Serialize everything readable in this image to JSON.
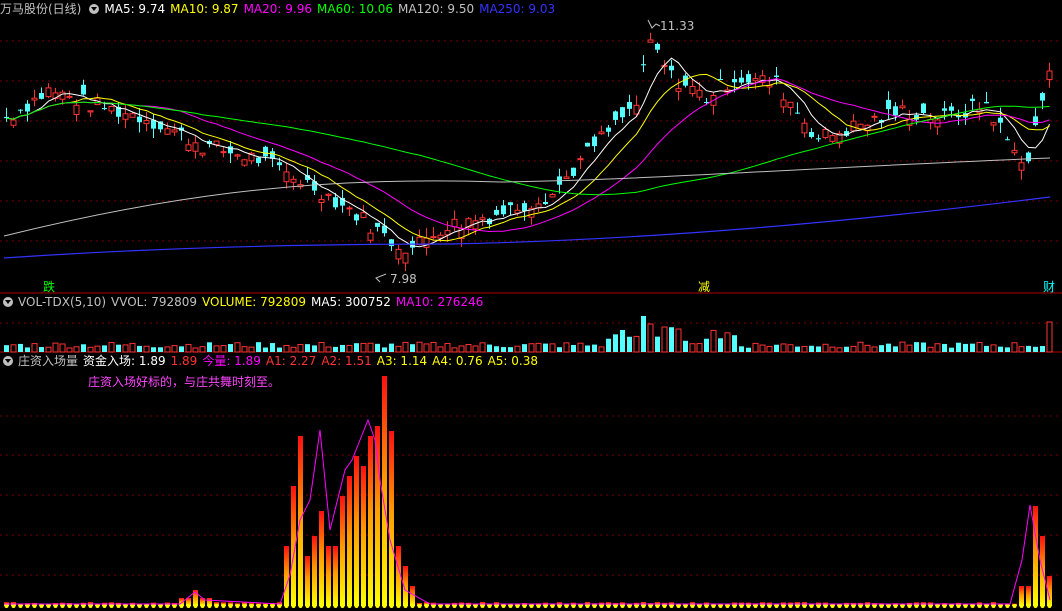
{
  "panel_main": {
    "title": "万马股份(日线)",
    "ma": [
      {
        "label": "MA5: 9.74",
        "color": "#ffffff"
      },
      {
        "label": "MA10: 9.87",
        "color": "#ffff00"
      },
      {
        "label": "MA20: 9.96",
        "color": "#ff00ff"
      },
      {
        "label": "MA60: 10.06",
        "color": "#00ff00"
      },
      {
        "label": "MA120: 9.50",
        "color": "#c0c0c0"
      },
      {
        "label": "MA250: 9.03",
        "color": "#3333ff"
      }
    ],
    "high_label": "11.33",
    "low_label": "7.98",
    "signals": [
      {
        "text": "跌",
        "color": "#00ff00"
      },
      {
        "text": "减",
        "color": "#ffff00"
      },
      {
        "text": "财",
        "color": "#00ffff"
      }
    ]
  },
  "panel_vol": {
    "title": "VOL-TDX(5,10)",
    "items": [
      {
        "label": "VVOL: 792809",
        "color": "#c0c0c0"
      },
      {
        "label": "VOLUME: 792809",
        "color": "#ffff00"
      },
      {
        "label": "MA5: 300752",
        "color": "#ffffff"
      },
      {
        "label": "MA10: 276246",
        "color": "#ff00ff"
      }
    ]
  },
  "panel_ind": {
    "title": "庄资入场量",
    "items": [
      {
        "label": "资金入场: 1.89",
        "color": "#ffffff"
      },
      {
        "label": "1.89",
        "color": "#ff3333"
      },
      {
        "label": "今量: 1.89",
        "color": "#ff00ff"
      },
      {
        "label": "A1: 2.27",
        "color": "#ff3333"
      },
      {
        "label": "A2: 1.51",
        "color": "#ff3333"
      },
      {
        "label": "A3: 1.14",
        "color": "#ffff00"
      },
      {
        "label": "A4: 0.76",
        "color": "#ffff00"
      },
      {
        "label": "A5: 0.38",
        "color": "#ffff00"
      }
    ],
    "note": "庄资入场好标的，与庄共舞时刻至。"
  },
  "colors": {
    "up": "#ff3333",
    "down": "#54ffff",
    "grid": "#7a0000",
    "border": "#b00000"
  }
}
